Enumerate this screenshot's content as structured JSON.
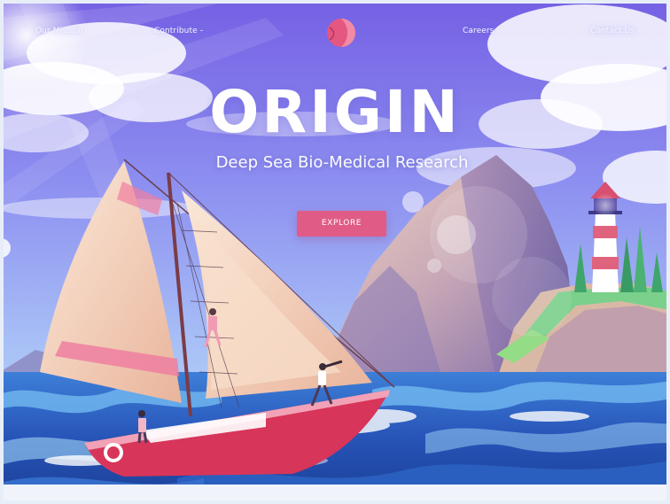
{
  "nav": {
    "links": [
      "Our Mission",
      "Contribute",
      "Careers",
      "Contact Us"
    ]
  },
  "logo": {
    "icon": "origin-logo-icon",
    "color": "#e45780"
  },
  "hero": {
    "title": "ORIGIN",
    "subtitle": "Deep Sea Bio-Medical Research",
    "cta_label": "EXPLORE"
  },
  "colors": {
    "accent": "#e05c86",
    "sky_top": "#7b62e6",
    "sky_mid": "#8ca2f0",
    "sea": "#2d5fc4",
    "sail": "#f6d6bf",
    "hull": "#d8355a"
  }
}
